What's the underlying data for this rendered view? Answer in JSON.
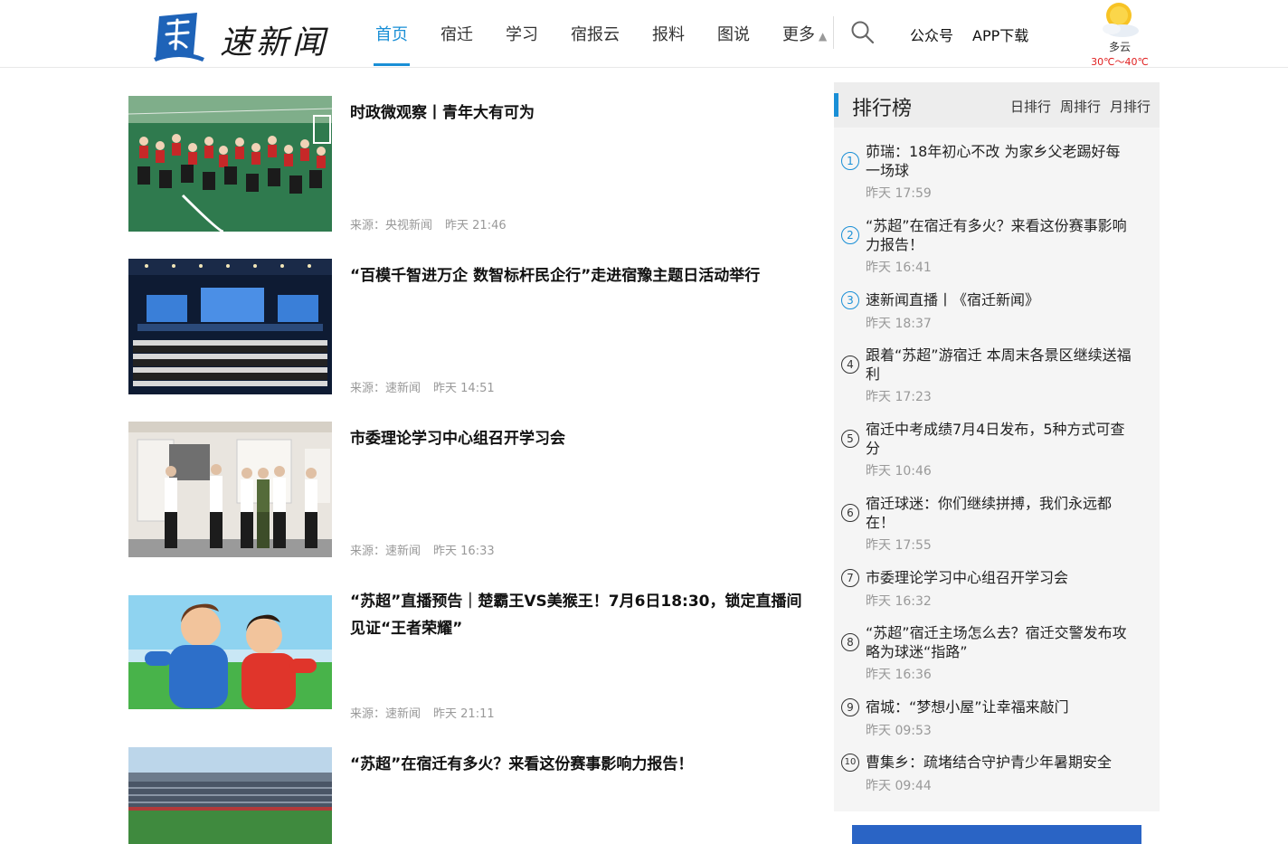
{
  "header": {
    "logo_text": "速新闻",
    "nav": [
      "首页",
      "宿迁",
      "学习",
      "宿报云",
      "报料",
      "图说",
      "更多"
    ],
    "more_caret": "▲",
    "links": [
      "公众号",
      "APP下载"
    ],
    "weather": {
      "condition": "多云",
      "temp": "30℃～40℃"
    }
  },
  "news": [
    {
      "title": "时政微观察丨青年大有可为",
      "source": "来源：央视新闻",
      "time": "昨天 21:46"
    },
    {
      "title": "“百模千智进万企 数智标杆民企行”走进宿豫主题日活动举行",
      "source": "来源：速新闻",
      "time": "昨天 14:51"
    },
    {
      "title": "市委理论学习中心组召开学习会",
      "source": "来源：速新闻",
      "time": "昨天 16:33"
    },
    {
      "title": "“苏超”直播预告｜楚霸王VS美猴王！7月6日18:30，锁定直播间见证“王者荣耀”",
      "source": "来源：速新闻",
      "time": "昨天 21:11"
    },
    {
      "title": "“苏超”在宿迁有多火？来看这份赛事影响力报告！",
      "source": "",
      "time": ""
    }
  ],
  "ranking": {
    "title": "排行榜",
    "tabs": [
      "日排行",
      "周排行",
      "月排行"
    ],
    "items": [
      {
        "num": "1",
        "title": "茆瑞：18年初心不改 为家乡父老踢好每一场球",
        "time": "昨天 17:59"
      },
      {
        "num": "2",
        "title": "“苏超”在宿迁有多火？来看这份赛事影响力报告！",
        "time": "昨天 16:41"
      },
      {
        "num": "3",
        "title": "速新闻直播丨《宿迁新闻》",
        "time": "昨天 18:37"
      },
      {
        "num": "4",
        "title": "跟着“苏超”游宿迁 本周末各景区继续送福利",
        "time": "昨天 17:23"
      },
      {
        "num": "5",
        "title": "宿迁中考成绩7月4日发布，5种方式可查分",
        "time": "昨天 10:46"
      },
      {
        "num": "6",
        "title": "宿迁球迷：你们继续拼搏，我们永远都在！",
        "time": "昨天 17:55"
      },
      {
        "num": "7",
        "title": "市委理论学习中心组召开学习会",
        "time": "昨天 16:32"
      },
      {
        "num": "8",
        "title": "“苏超”宿迁主场怎么去？宿迁交警发布攻略为球迷“指路”",
        "time": "昨天 16:36"
      },
      {
        "num": "9",
        "title": "宿城：“梦想小屋”让幸福来敲门",
        "time": "昨天 09:53"
      },
      {
        "num": "10",
        "title": "曹集乡：疏堵结合守护青少年暑期安全",
        "time": "昨天 09:44"
      }
    ]
  },
  "colors": {
    "accent": "#1a8fd6",
    "temp": "#e02020"
  }
}
